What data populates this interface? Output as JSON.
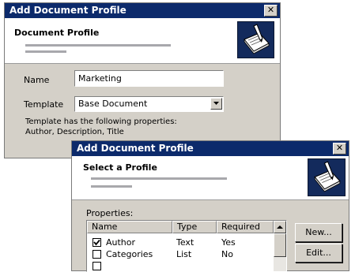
{
  "back_dialog": {
    "title": "Add Document Profile",
    "close_glyph": "✕",
    "header_title": "Document Profile",
    "name_label": "Name",
    "name_value": "Marketing",
    "template_label": "Template",
    "template_value": "Base Document",
    "info_line1": "Template has the following properties:",
    "info_line2": "Author, Description, Title"
  },
  "front_dialog": {
    "title": "Add Document Profile",
    "close_glyph": "✕",
    "header_title": "Select a Profile",
    "properties_label": "Properties:",
    "columns": [
      "Name",
      "Type",
      "Required"
    ],
    "rows": [
      {
        "checked": true,
        "name": "Author",
        "type": "Text",
        "required": "Yes"
      },
      {
        "checked": false,
        "name": "Categories",
        "type": "List",
        "required": "No"
      }
    ],
    "new_button": "New...",
    "edit_button": "Edit..."
  },
  "icons": {
    "logo": "document-profile-icon",
    "close": "close-icon",
    "dropdown": "chevron-down-icon",
    "scroll_up": "scroll-up-arrow-icon",
    "checkmark": "checkmark-icon"
  },
  "colors": {
    "titlebar": "#0c2a6b",
    "dialog_face": "#d4d0c8",
    "header_bg": "#ffffff",
    "logo_bg": "#132a5c"
  }
}
